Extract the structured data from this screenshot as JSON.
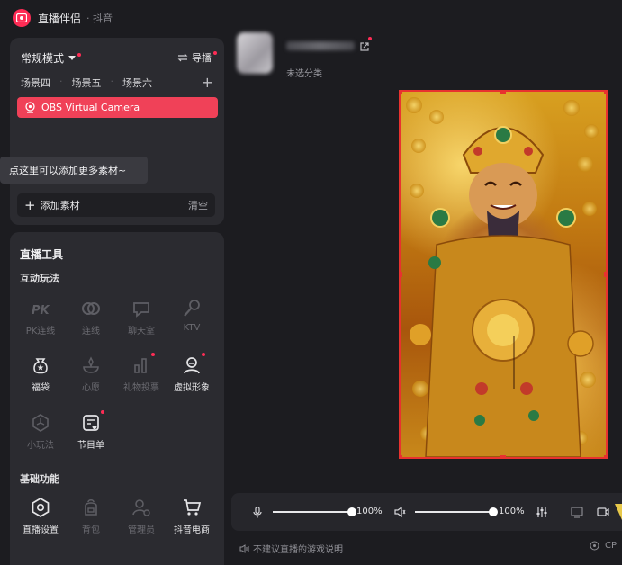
{
  "header": {
    "title": "直播伴侣",
    "subtitle": "· 抖音"
  },
  "scene": {
    "mode_label": "常规模式",
    "guide_label": "导播",
    "tabs": [
      "场景四",
      "场景五",
      "场景六"
    ],
    "source_name": "OBS Virtual Camera",
    "tooltip": "点这里可以添加更多素材~",
    "add_material_label": "添加素材",
    "clear_label": "清空"
  },
  "tools": {
    "title": "直播工具",
    "interactive_title": "互动玩法",
    "interactive": [
      {
        "label": "PK连线",
        "icon": "pk-icon",
        "enabled": false
      },
      {
        "label": "连线",
        "icon": "link-icon",
        "enabled": false
      },
      {
        "label": "聊天室",
        "icon": "chatroom-icon",
        "enabled": false
      },
      {
        "label": "KTV",
        "icon": "microphone-icon",
        "enabled": false
      },
      {
        "label": "福袋",
        "icon": "lucky-bag-icon",
        "enabled": true
      },
      {
        "label": "心愿",
        "icon": "wish-icon",
        "enabled": false
      },
      {
        "label": "礼物投票",
        "icon": "gift-vote-icon",
        "enabled": false
      },
      {
        "label": "虚拟形象",
        "icon": "avatar-icon",
        "enabled": true
      },
      {
        "label": "小玩法",
        "icon": "mini-game-icon",
        "enabled": false
      },
      {
        "label": "节目单",
        "icon": "program-list-icon",
        "enabled": true
      }
    ],
    "basic_title": "基础功能",
    "basic": [
      {
        "label": "直播设置",
        "icon": "live-settings-icon",
        "enabled": true
      },
      {
        "label": "背包",
        "icon": "backpack-icon",
        "enabled": false
      },
      {
        "label": "管理员",
        "icon": "admin-icon",
        "enabled": false
      },
      {
        "label": "抖音电商",
        "icon": "cart-icon",
        "enabled": true
      }
    ]
  },
  "profile": {
    "category": "未选分类"
  },
  "audio": {
    "mic_volume": "100%",
    "speaker_volume": "100%",
    "mic_level": 1.0,
    "speaker_level": 1.0
  },
  "footer": {
    "note": "不建议直播的游戏说明",
    "cpu_label": "CP"
  },
  "colors": {
    "accent": "#fe2c55",
    "selection": "#e8322f",
    "source_bg": "#f04158"
  }
}
